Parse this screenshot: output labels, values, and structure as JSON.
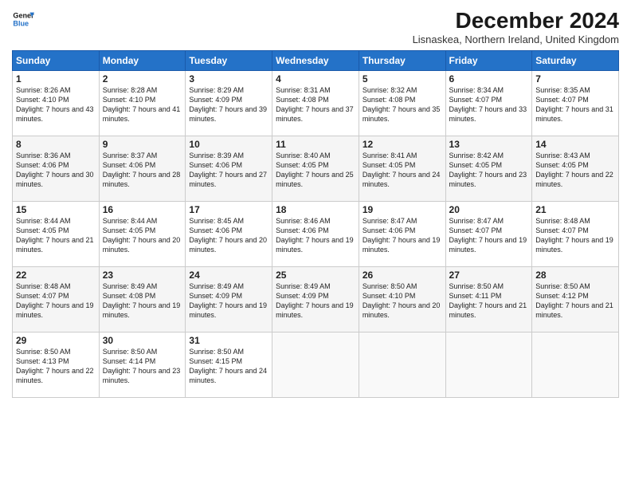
{
  "logo": {
    "line1": "General",
    "line2": "Blue"
  },
  "title": "December 2024",
  "location": "Lisnaskea, Northern Ireland, United Kingdom",
  "days_of_week": [
    "Sunday",
    "Monday",
    "Tuesday",
    "Wednesday",
    "Thursday",
    "Friday",
    "Saturday"
  ],
  "weeks": [
    [
      {
        "day": "1",
        "sunrise": "8:26 AM",
        "sunset": "4:10 PM",
        "daylight": "7 hours and 43 minutes."
      },
      {
        "day": "2",
        "sunrise": "8:28 AM",
        "sunset": "4:10 PM",
        "daylight": "7 hours and 41 minutes."
      },
      {
        "day": "3",
        "sunrise": "8:29 AM",
        "sunset": "4:09 PM",
        "daylight": "7 hours and 39 minutes."
      },
      {
        "day": "4",
        "sunrise": "8:31 AM",
        "sunset": "4:08 PM",
        "daylight": "7 hours and 37 minutes."
      },
      {
        "day": "5",
        "sunrise": "8:32 AM",
        "sunset": "4:08 PM",
        "daylight": "7 hours and 35 minutes."
      },
      {
        "day": "6",
        "sunrise": "8:34 AM",
        "sunset": "4:07 PM",
        "daylight": "7 hours and 33 minutes."
      },
      {
        "day": "7",
        "sunrise": "8:35 AM",
        "sunset": "4:07 PM",
        "daylight": "7 hours and 31 minutes."
      }
    ],
    [
      {
        "day": "8",
        "sunrise": "8:36 AM",
        "sunset": "4:06 PM",
        "daylight": "7 hours and 30 minutes."
      },
      {
        "day": "9",
        "sunrise": "8:37 AM",
        "sunset": "4:06 PM",
        "daylight": "7 hours and 28 minutes."
      },
      {
        "day": "10",
        "sunrise": "8:39 AM",
        "sunset": "4:06 PM",
        "daylight": "7 hours and 27 minutes."
      },
      {
        "day": "11",
        "sunrise": "8:40 AM",
        "sunset": "4:05 PM",
        "daylight": "7 hours and 25 minutes."
      },
      {
        "day": "12",
        "sunrise": "8:41 AM",
        "sunset": "4:05 PM",
        "daylight": "7 hours and 24 minutes."
      },
      {
        "day": "13",
        "sunrise": "8:42 AM",
        "sunset": "4:05 PM",
        "daylight": "7 hours and 23 minutes."
      },
      {
        "day": "14",
        "sunrise": "8:43 AM",
        "sunset": "4:05 PM",
        "daylight": "7 hours and 22 minutes."
      }
    ],
    [
      {
        "day": "15",
        "sunrise": "8:44 AM",
        "sunset": "4:05 PM",
        "daylight": "7 hours and 21 minutes."
      },
      {
        "day": "16",
        "sunrise": "8:44 AM",
        "sunset": "4:05 PM",
        "daylight": "7 hours and 20 minutes."
      },
      {
        "day": "17",
        "sunrise": "8:45 AM",
        "sunset": "4:06 PM",
        "daylight": "7 hours and 20 minutes."
      },
      {
        "day": "18",
        "sunrise": "8:46 AM",
        "sunset": "4:06 PM",
        "daylight": "7 hours and 19 minutes."
      },
      {
        "day": "19",
        "sunrise": "8:47 AM",
        "sunset": "4:06 PM",
        "daylight": "7 hours and 19 minutes."
      },
      {
        "day": "20",
        "sunrise": "8:47 AM",
        "sunset": "4:07 PM",
        "daylight": "7 hours and 19 minutes."
      },
      {
        "day": "21",
        "sunrise": "8:48 AM",
        "sunset": "4:07 PM",
        "daylight": "7 hours and 19 minutes."
      }
    ],
    [
      {
        "day": "22",
        "sunrise": "8:48 AM",
        "sunset": "4:07 PM",
        "daylight": "7 hours and 19 minutes."
      },
      {
        "day": "23",
        "sunrise": "8:49 AM",
        "sunset": "4:08 PM",
        "daylight": "7 hours and 19 minutes."
      },
      {
        "day": "24",
        "sunrise": "8:49 AM",
        "sunset": "4:09 PM",
        "daylight": "7 hours and 19 minutes."
      },
      {
        "day": "25",
        "sunrise": "8:49 AM",
        "sunset": "4:09 PM",
        "daylight": "7 hours and 19 minutes."
      },
      {
        "day": "26",
        "sunrise": "8:50 AM",
        "sunset": "4:10 PM",
        "daylight": "7 hours and 20 minutes."
      },
      {
        "day": "27",
        "sunrise": "8:50 AM",
        "sunset": "4:11 PM",
        "daylight": "7 hours and 21 minutes."
      },
      {
        "day": "28",
        "sunrise": "8:50 AM",
        "sunset": "4:12 PM",
        "daylight": "7 hours and 21 minutes."
      }
    ],
    [
      {
        "day": "29",
        "sunrise": "8:50 AM",
        "sunset": "4:13 PM",
        "daylight": "7 hours and 22 minutes."
      },
      {
        "day": "30",
        "sunrise": "8:50 AM",
        "sunset": "4:14 PM",
        "daylight": "7 hours and 23 minutes."
      },
      {
        "day": "31",
        "sunrise": "8:50 AM",
        "sunset": "4:15 PM",
        "daylight": "7 hours and 24 minutes."
      },
      null,
      null,
      null,
      null
    ]
  ]
}
